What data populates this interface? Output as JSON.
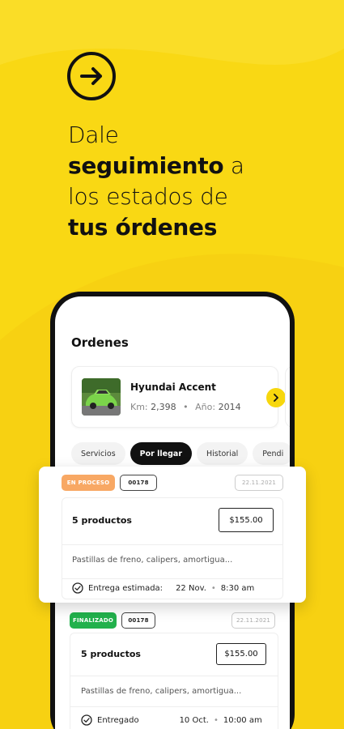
{
  "headline": {
    "line1": "Dale",
    "line2_bold": "seguimiento",
    "line2_light": " a",
    "line3": "los estados de",
    "line4": "tus órdenes"
  },
  "screen": {
    "title": "Ordenes",
    "vehicle": {
      "name": "Hyundai Accent",
      "km_label": "Km:",
      "km_value": "2,398",
      "year_label": "Año:",
      "year_value": "2014"
    },
    "tabs": [
      {
        "label": "Servicios"
      },
      {
        "label": "Por llegar"
      },
      {
        "label": "Historial"
      },
      {
        "label": "Pendi"
      }
    ]
  },
  "orders": [
    {
      "status": "EN PROCESO",
      "code": "00178",
      "date": "22.11.2021",
      "products": "5 productos",
      "price": "$155.00",
      "description": "Pastillas de freno, calipers, amortigua...",
      "delivery_label": "Entrega estimada:",
      "delivery_date": "22 Nov.",
      "delivery_time": "8:30 am"
    },
    {
      "status": "FINALIZADO",
      "code": "00178",
      "date": "22.11.2021",
      "products": "5 productos",
      "price": "$155.00",
      "description": "Pastillas de freno, calipers, amortigua...",
      "delivery_label": "Entregado",
      "delivery_date": "10 Oct.",
      "delivery_time": "10:00 am"
    }
  ],
  "colors": {
    "background": "#f9d814",
    "accent": "#f7d70d",
    "in_progress": "#f8a864",
    "finished": "#22b14c"
  },
  "icons": [
    "arrow-right-circle-icon",
    "chevron-right-icon",
    "check-circle-icon"
  ]
}
